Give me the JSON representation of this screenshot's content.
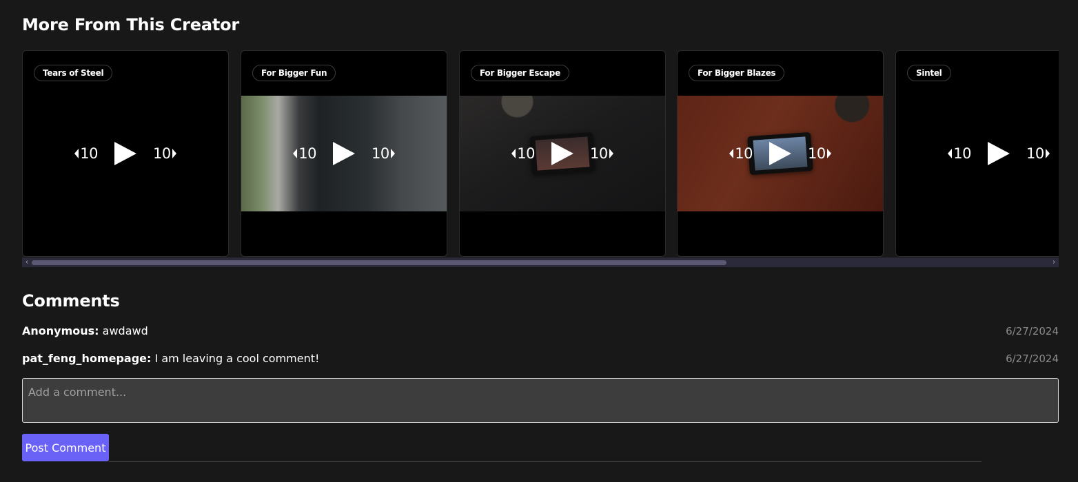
{
  "more_section": {
    "title": "More From This Creator"
  },
  "videos": [
    {
      "title": "Tears of Steel",
      "thumb": "none",
      "rewind": "10",
      "forward": "10"
    },
    {
      "title": "For Bigger Fun",
      "thumb": "fun",
      "rewind": "10",
      "forward": "10"
    },
    {
      "title": "For Bigger Escape",
      "thumb": "escape",
      "rewind": "10",
      "forward": "10"
    },
    {
      "title": "For Bigger Blazes",
      "thumb": "blazes",
      "rewind": "10",
      "forward": "10"
    },
    {
      "title": "Sintel",
      "thumb": "none",
      "rewind": "10",
      "forward": "10"
    }
  ],
  "scrollbar": {
    "left_icon": "chevron-left-icon",
    "right_icon": "chevron-right-icon"
  },
  "comments_section": {
    "title": "Comments",
    "comments": [
      {
        "author": "Anonymous:",
        "text": "awdawd",
        "date": "6/27/2024"
      },
      {
        "author": "pat_feng_homepage:",
        "text": "I am leaving a cool comment!",
        "date": "6/27/2024"
      }
    ],
    "input_placeholder": "Add a comment...",
    "post_label": "Post Comment"
  },
  "colors": {
    "background": "#181818",
    "accent": "#6a62f7",
    "scroll_track": "#2b2a3a",
    "date_text": "#8c8c8c"
  }
}
